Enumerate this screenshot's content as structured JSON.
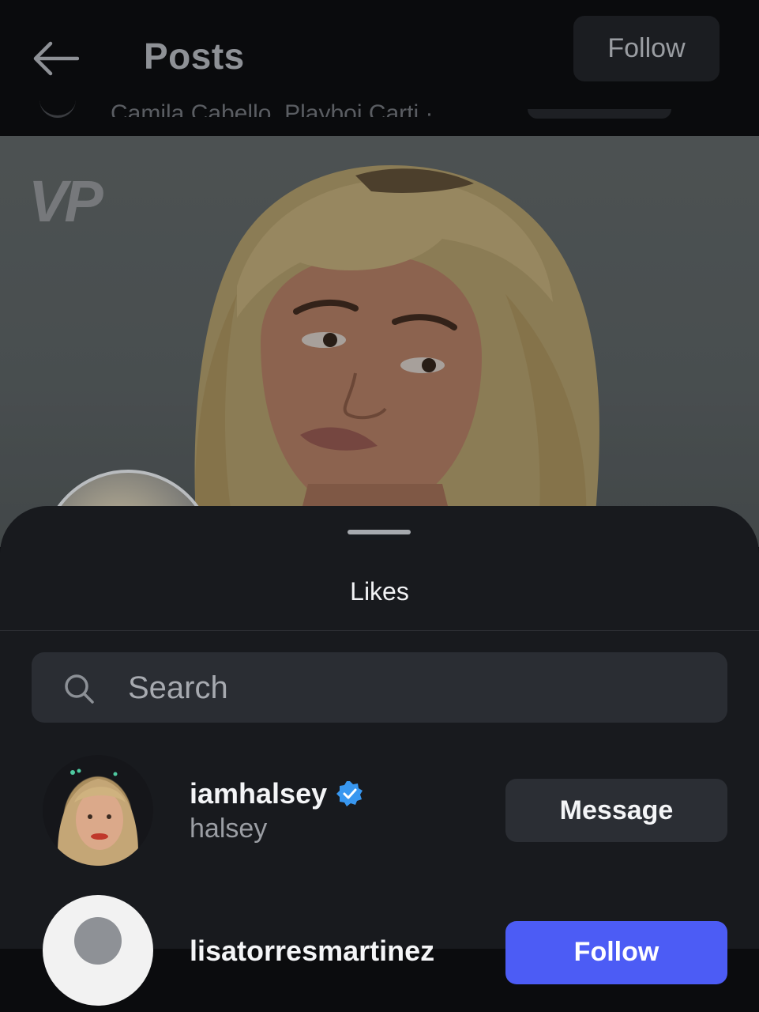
{
  "header": {
    "title": "Posts",
    "follow_label": "Follow",
    "audio_line": "Camila Cabello, Playboi Carti · ..."
  },
  "post": {
    "watermark": "VP"
  },
  "likes_sheet": {
    "title": "Likes",
    "search": {
      "placeholder": "Search",
      "value": ""
    },
    "users": [
      {
        "username": "iamhalsey",
        "full_name": "halsey",
        "verified": true,
        "action_label": "Message"
      },
      {
        "username": "lisatorresmartinez",
        "full_name": "",
        "verified": false,
        "action_label": "Follow"
      }
    ]
  },
  "colors": {
    "follow_accent": "#4c5cf5",
    "verified_badge": "#3897f0",
    "sheet_background": "#181a1e"
  },
  "icons": [
    "back-arrow-icon",
    "search-icon",
    "verified-badge-icon",
    "default-avatar-icon"
  ]
}
